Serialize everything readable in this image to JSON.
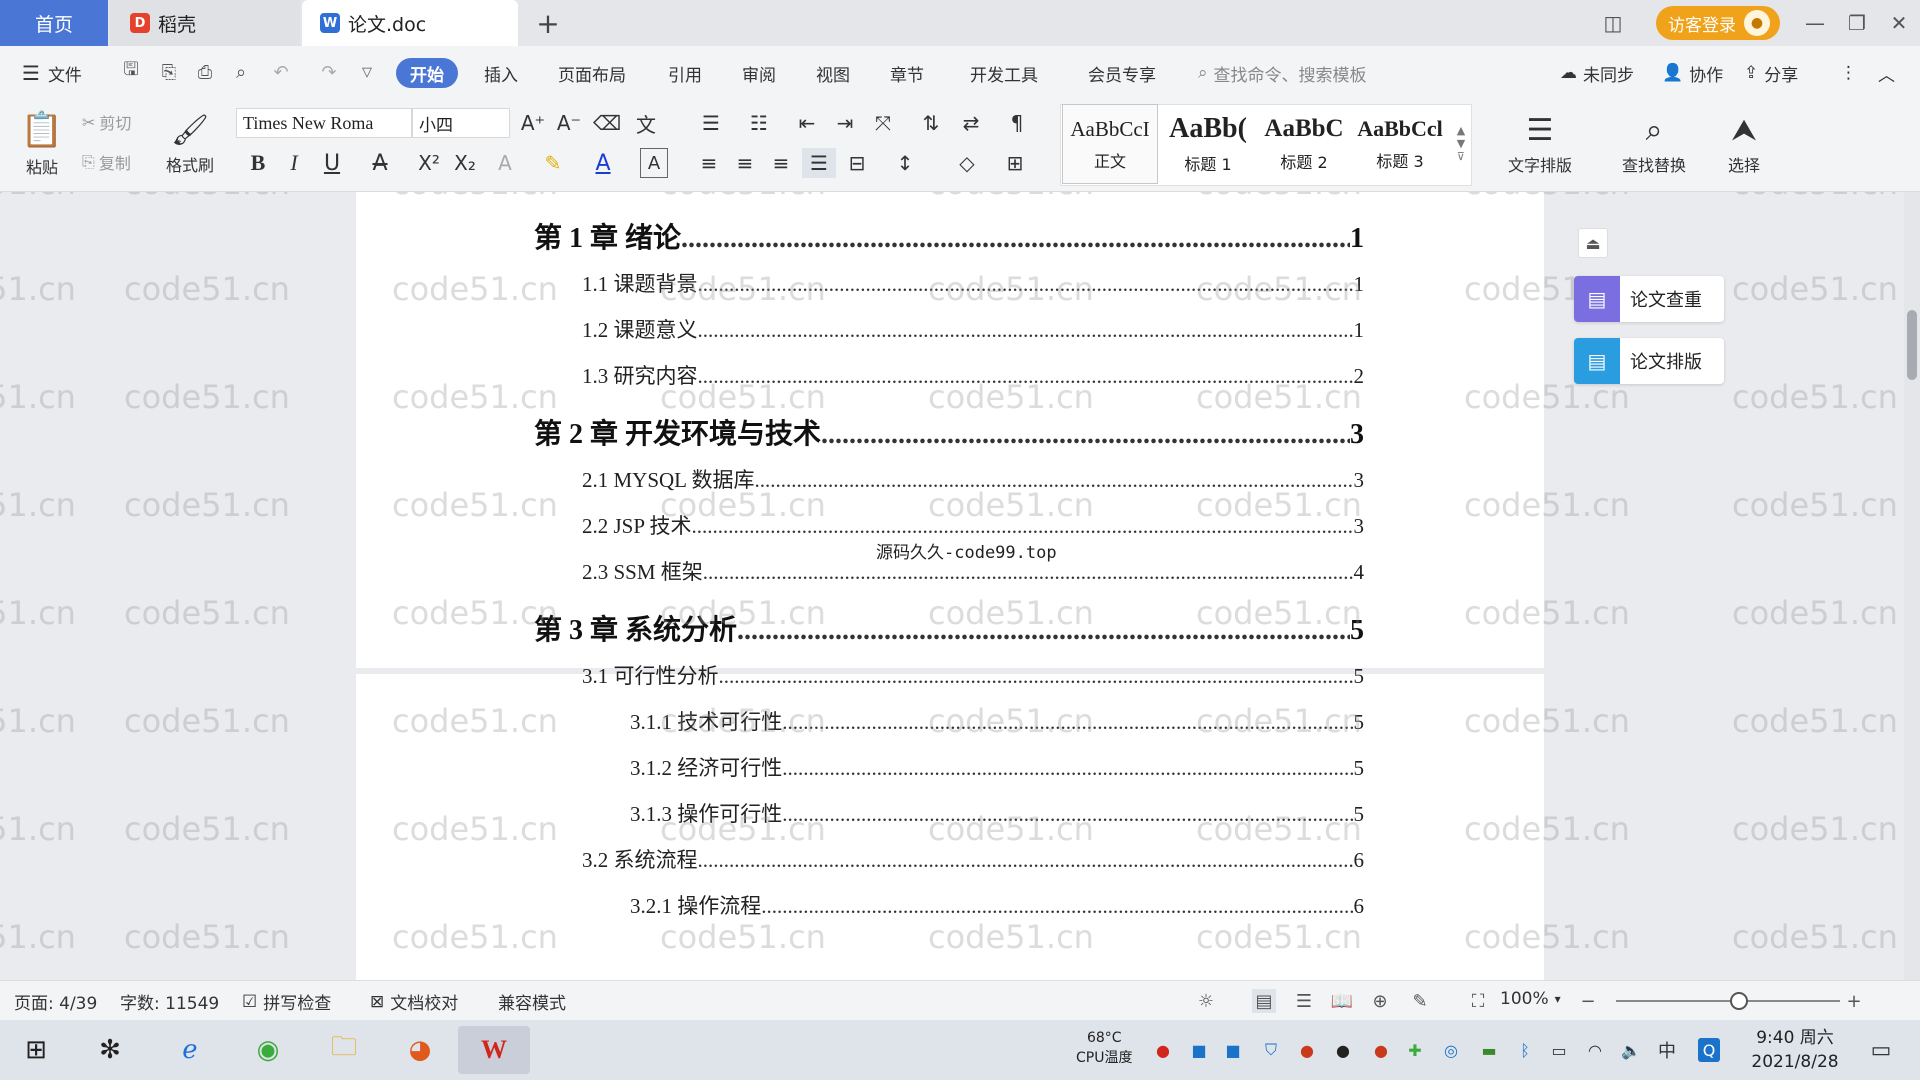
{
  "tabs": {
    "home": "首页",
    "daoke": "稻壳",
    "doc": "论文.doc",
    "add": "+"
  },
  "login": {
    "label": "访客登录"
  },
  "menu": {
    "file": "文件",
    "items": [
      "开始",
      "插入",
      "页面布局",
      "引用",
      "审阅",
      "视图",
      "章节",
      "开发工具",
      "会员专享"
    ],
    "search_placeholder": "查找命令、搜索模板",
    "sync": "未同步",
    "collab": "协作",
    "share": "分享"
  },
  "ribbon": {
    "paste": "粘贴",
    "cut": "剪切",
    "copy": "复制",
    "format_painter": "格式刷",
    "font_name": "Times New Roma",
    "font_size": "小四",
    "styles": [
      {
        "preview": "AaBbCcI",
        "name": "正文"
      },
      {
        "preview": "AaBb(",
        "name": "标题 1"
      },
      {
        "preview": "AaBbC",
        "name": "标题 2"
      },
      {
        "preview": "AaBbCcl",
        "name": "标题 3"
      }
    ],
    "text_layout": "文字排版",
    "find_replace": "查找替换",
    "select": "选择"
  },
  "toc": [
    {
      "level": 0,
      "title": "第 1 章  绪论",
      "page": "1"
    },
    {
      "level": 1,
      "title": "1.1  课题背景",
      "page": "1"
    },
    {
      "level": 1,
      "title": "1.2  课题意义",
      "page": "1"
    },
    {
      "level": 1,
      "title": "1.3  研究内容",
      "page": "2"
    },
    {
      "level": 0,
      "title": "第 2 章  开发环境与技术",
      "page": "3"
    },
    {
      "level": 1,
      "title": "2.1 MYSQL 数据库",
      "page": "3"
    },
    {
      "level": 1,
      "title": "2.2 JSP 技术",
      "page": "3"
    },
    {
      "level": 1,
      "title": "2.3 SSM 框架",
      "page": "4"
    },
    {
      "level": 0,
      "title": "第 3 章  系统分析",
      "page": "5"
    },
    {
      "level": 1,
      "title": "3.1  可行性分析",
      "page": "5"
    },
    {
      "level": 2,
      "title": "3.1.1  技术可行性",
      "page": "5"
    },
    {
      "level": 2,
      "title": "3.1.2  经济可行性",
      "page": "5"
    },
    {
      "level": 2,
      "title": "3.1.3  操作可行性",
      "page": "5"
    },
    {
      "level": 1,
      "title": "3.2  系统流程",
      "page": "6"
    },
    {
      "level": 2,
      "title": "3.2.1  操作流程",
      "page": "6"
    }
  ],
  "overlay_text": "源码久久-code99.top",
  "watermark": "code51.cn",
  "side_panel": {
    "check": "论文查重",
    "layout": "论文排版"
  },
  "status": {
    "page": "页面: 4/39",
    "words": "字数: 11549",
    "spell": "拼写检查",
    "proof": "文档校对",
    "compat": "兼容模式",
    "zoom": "100%",
    "zoom_level": 0.55
  },
  "taskbar": {
    "temp": "68°C",
    "cpu": "CPU温度",
    "ime": "中",
    "time": "9:40 周六",
    "date": "2021/8/28"
  },
  "colors": {
    "accent": "#4a77d6",
    "login": "#f0a21a",
    "wps_red": "#d0261c"
  }
}
